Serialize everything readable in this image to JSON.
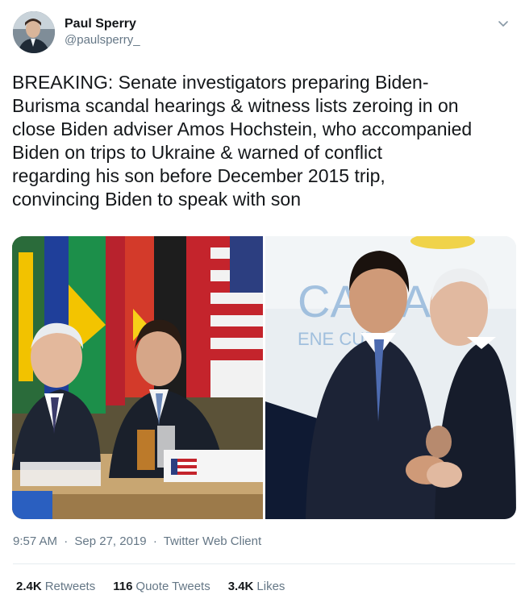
{
  "author": {
    "display_name": "Paul Sperry",
    "handle": "@paulsperry_"
  },
  "tweet": {
    "text": "BREAKING: Senate investigators preparing Biden-\nBurisma scandal hearings & witness lists zeroing in on\nclose Biden adviser Amos Hochstein, who accompanied\nBiden on trips to Ukraine & warned of conflict\nregarding his son before December 2015 trip,\nconvincing Biden to speak with son"
  },
  "photos": {
    "left_placard": "USA",
    "right_sign_top": "CA   EAN",
    "right_sign_bottom": "ENE      CUR"
  },
  "meta": {
    "time": "9:57 AM",
    "separator": "·",
    "date": "Sep 27, 2019",
    "client": "Twitter Web Client"
  },
  "stats": {
    "retweets_count": "2.4K",
    "retweets_label": "Retweets",
    "quotes_count": "116",
    "quotes_label": "Quote Tweets",
    "likes_count": "3.4K",
    "likes_label": "Likes"
  },
  "icons": {
    "caret": "chevron-down-icon"
  },
  "colors": {
    "text_primary": "#14171a",
    "text_secondary": "#657786",
    "divider": "#e6ecf0"
  }
}
